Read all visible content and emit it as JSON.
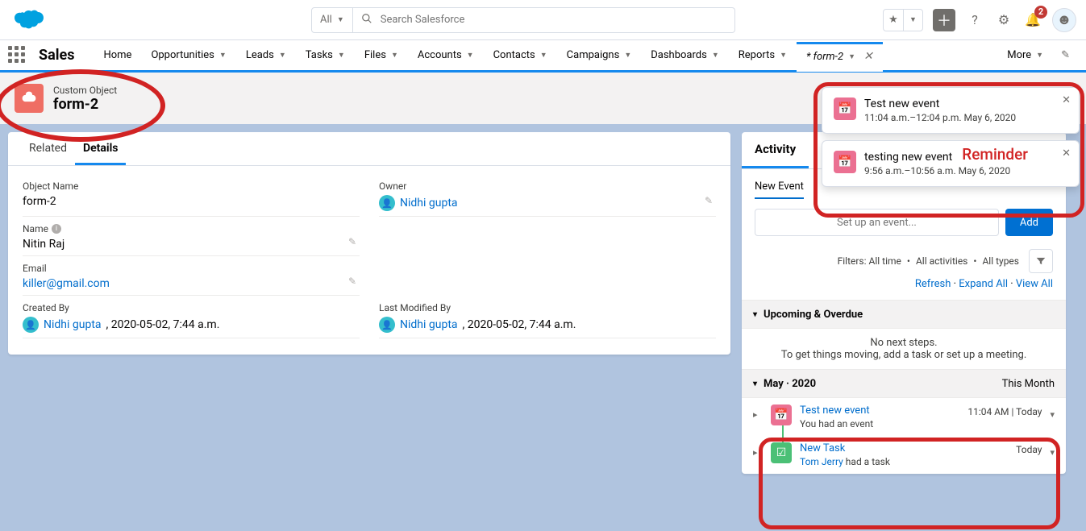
{
  "header": {
    "scope": "All",
    "search_placeholder": "Search Salesforce",
    "notif_count": "2"
  },
  "nav": {
    "app_name": "Sales",
    "items": [
      "Home",
      "Opportunities",
      "Leads",
      "Tasks",
      "Files",
      "Accounts",
      "Contacts",
      "Campaigns",
      "Dashboards",
      "Reports"
    ],
    "workspace_tab": "* form-2",
    "more": "More"
  },
  "record": {
    "type_label": "Custom Object",
    "name": "form-2"
  },
  "tabs": {
    "related": "Related",
    "details": "Details"
  },
  "fields": {
    "object_name_label": "Object Name",
    "object_name_value": "form-2",
    "owner_label": "Owner",
    "owner_value": "Nidhi gupta",
    "name_label": "Name",
    "name_value": "Nitin Raj",
    "email_label": "Email",
    "email_value": "killer@gmail.com",
    "created_by_label": "Created By",
    "created_by_user": "Nidhi gupta",
    "created_by_ts": ", 2020-05-02, 7:44 a.m.",
    "modified_by_label": "Last Modified By",
    "modified_by_user": "Nidhi gupta",
    "modified_by_ts": ", 2020-05-02, 7:44 a.m."
  },
  "activity": {
    "tab_activity": "Activity",
    "composer_tabs": [
      "New Event"
    ],
    "composer_placeholder": "Set up an event...",
    "add_label": "Add",
    "filters_text": "Filters: All time",
    "filters_activities": "All activities",
    "filters_types": "All types",
    "refresh": "Refresh",
    "expand_all": "Expand All",
    "view_all": "View All",
    "upcoming_title": "Upcoming & Overdue",
    "upcoming_empty1": "No next steps.",
    "upcoming_empty2": "To get things moving, add a task or set up a meeting.",
    "month_title": "May · 2020",
    "month_badge": "This Month",
    "timeline": [
      {
        "title": "Test new event",
        "sub": "You had an event",
        "meta": "11:04 AM | Today",
        "color": "pink"
      },
      {
        "title": "New Task",
        "sub_prefix_user": "Tom Jerry",
        "sub_suffix": " had a task",
        "meta": "Today",
        "color": "green"
      }
    ]
  },
  "reminders": [
    {
      "title": "Test new event",
      "sub": "11:04 a.m.–12:04 p.m. May 6, 2020"
    },
    {
      "title": "testing new event",
      "sub": "9:56 a.m.–10:56 a.m. May 6, 2020"
    }
  ],
  "annotations": {
    "reminder_label": "Reminder"
  }
}
